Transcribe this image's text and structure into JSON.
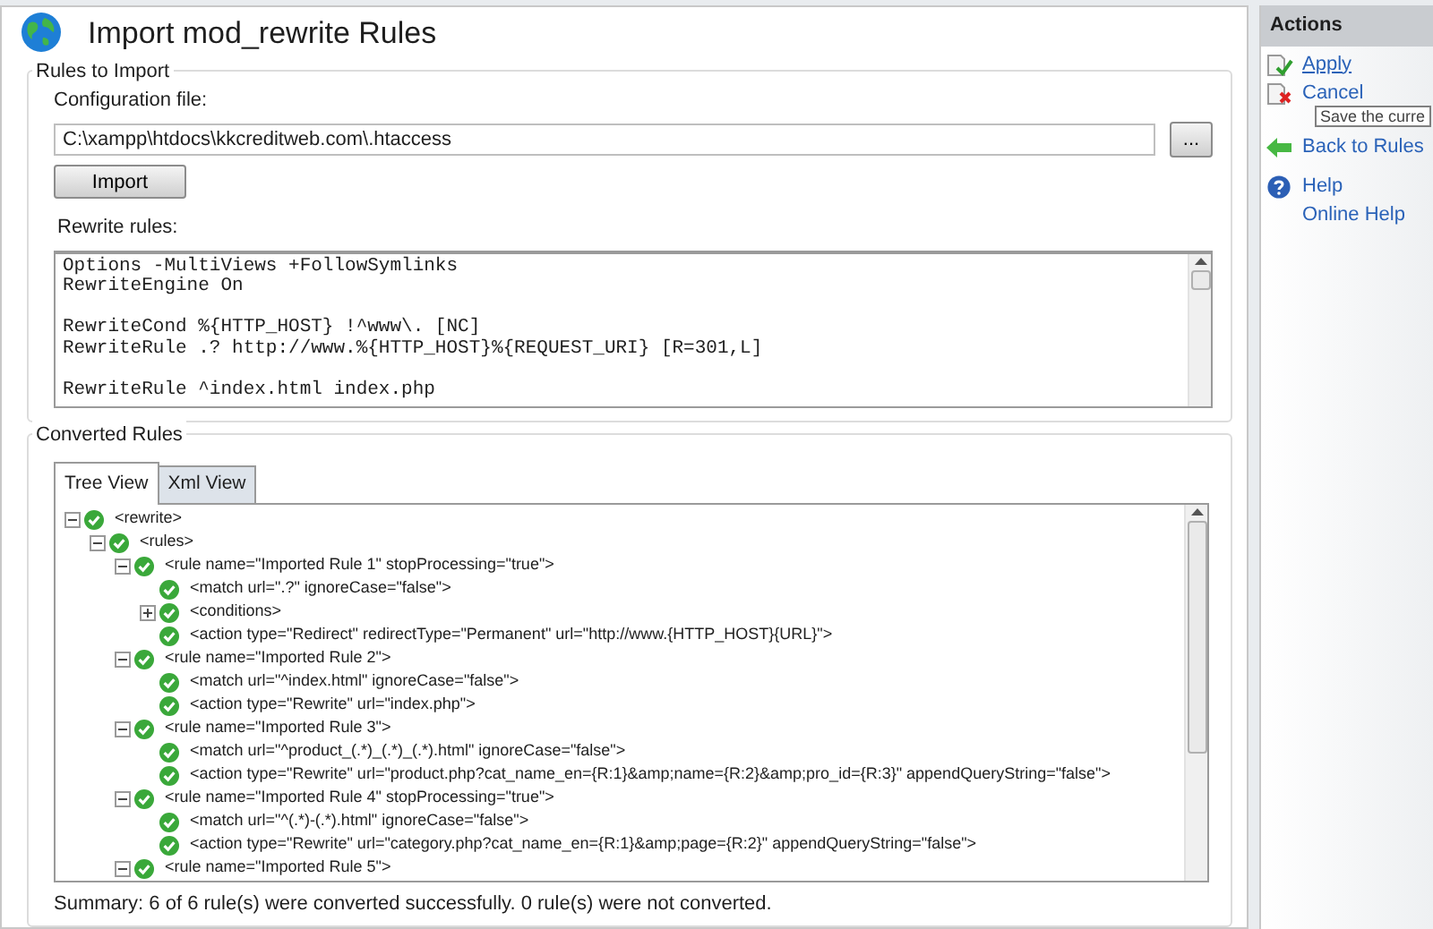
{
  "page": {
    "title": "Import mod_rewrite Rules"
  },
  "rules_to_import": {
    "legend": "Rules to Import",
    "config_label": "Configuration file:",
    "config_value": "C:\\xampp\\htdocs\\kkcreditweb.com\\.htaccess",
    "browse_button": "...",
    "import_button": "Import",
    "rules_label": "Rewrite rules:",
    "rules_blocks": [
      [
        "Options -MultiViews +FollowSymlinks",
        "RewriteEngine On"
      ],
      [
        "RewriteCond %{HTTP_HOST} !^www\\. [NC]",
        "RewriteRule .? http://www.%{HTTP_HOST}%{REQUEST_URI} [R=301,L]"
      ],
      [
        "RewriteRule ^index.html index.php"
      ]
    ]
  },
  "converted_rules": {
    "legend": "Converted Rules",
    "tabs": [
      {
        "label": "Tree View",
        "selected": true
      },
      {
        "label": "Xml View",
        "selected": false
      }
    ],
    "tree": [
      {
        "label": "<rewrite>",
        "expanded": true,
        "children": [
          {
            "label": "<rules>",
            "expanded": true,
            "children": [
              {
                "label": "<rule name=\"Imported Rule 1\" stopProcessing=\"true\">",
                "expanded": true,
                "children": [
                  {
                    "label": "<match url=\".?\" ignoreCase=\"false\">"
                  },
                  {
                    "label": "<conditions>",
                    "expanded": false
                  },
                  {
                    "label": "<action type=\"Redirect\" redirectType=\"Permanent\" url=\"http://www.{HTTP_HOST}{URL}\">"
                  }
                ]
              },
              {
                "label": "<rule name=\"Imported Rule 2\">",
                "expanded": true,
                "children": [
                  {
                    "label": "<match url=\"^index.html\" ignoreCase=\"false\">"
                  },
                  {
                    "label": "<action type=\"Rewrite\" url=\"index.php\">"
                  }
                ]
              },
              {
                "label": "<rule name=\"Imported Rule 3\">",
                "expanded": true,
                "children": [
                  {
                    "label": "<match url=\"^product_(.*)_(.*)_(.*).html\" ignoreCase=\"false\">"
                  },
                  {
                    "label": "<action type=\"Rewrite\" url=\"product.php?cat_name_en={R:1}&amp;name={R:2}&amp;pro_id={R:3}\" appendQueryString=\"false\">"
                  }
                ]
              },
              {
                "label": "<rule name=\"Imported Rule 4\" stopProcessing=\"true\">",
                "expanded": true,
                "children": [
                  {
                    "label": "<match url=\"^(.*)-(.*).html\" ignoreCase=\"false\">"
                  },
                  {
                    "label": "<action type=\"Rewrite\" url=\"category.php?cat_name_en={R:1}&amp;page={R:2}\" appendQueryString=\"false\">"
                  }
                ]
              },
              {
                "label": "<rule name=\"Imported Rule 5\">",
                "expanded": true
              }
            ]
          }
        ]
      }
    ],
    "summary": "Summary: 6 of 6 rule(s) were converted successfully. 0 rule(s) were not converted."
  },
  "actions": {
    "title": "Actions",
    "items": [
      {
        "kind": "apply",
        "label": "Apply"
      },
      {
        "kind": "cancel",
        "label": "Cancel"
      },
      {
        "kind": "back",
        "label": "Back to Rules"
      },
      {
        "kind": "help",
        "label": "Help"
      },
      {
        "kind": "plain",
        "label": "Online Help"
      }
    ],
    "tooltip": "Save the curre"
  }
}
